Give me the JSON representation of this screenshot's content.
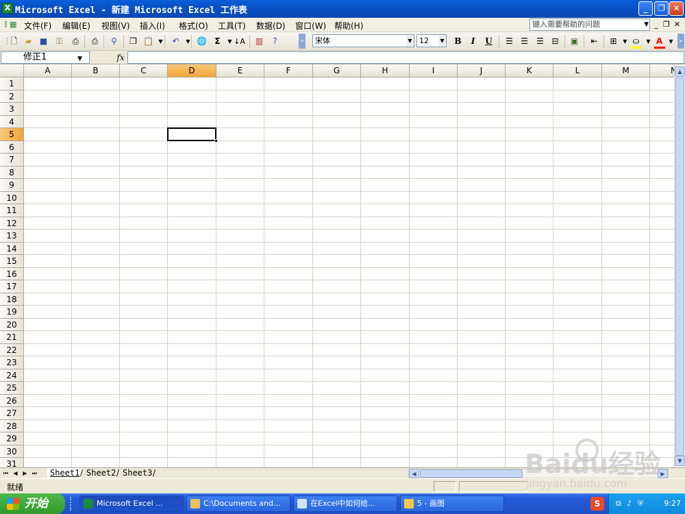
{
  "window": {
    "title": "Microsoft Excel - 新建 Microsoft Excel 工作表",
    "app_icon": "excel-icon",
    "controls": [
      "minimize",
      "restore",
      "close"
    ]
  },
  "menubar": {
    "items": [
      "文件(F)",
      "编辑(E)",
      "视图(V)",
      "插入(I)",
      "格式(O)",
      "工具(T)",
      "数据(D)",
      "窗口(W)",
      "帮助(H)"
    ],
    "help_placeholder": "键入需要帮助的问题"
  },
  "toolbar": {
    "font_name": "宋体",
    "font_size": "12",
    "bold": "B",
    "italic": "I",
    "underline": "U",
    "sum": "Σ",
    "icons": [
      "new-icon",
      "open-icon",
      "save-icon",
      "permission-icon",
      "print-icon",
      "print-preview-icon",
      "research-icon",
      "copy-icon",
      "paste-icon",
      "undo-icon",
      "hyperlink-icon",
      "autosum-icon",
      "sort-ascending-icon",
      "chart-wizard-icon",
      "help-icon",
      "align-left-icon",
      "align-center-icon",
      "align-right-icon",
      "merge-center-icon",
      "currency-icon",
      "decrease-indent-icon",
      "borders-icon",
      "fill-color-icon",
      "font-color-icon"
    ],
    "accent_fill": "#ffff00",
    "accent_font": "#ff0000"
  },
  "formula_bar": {
    "name_box": "修正1",
    "fx": "fx",
    "formula": ""
  },
  "grid": {
    "columns": [
      "A",
      "B",
      "C",
      "D",
      "E",
      "F",
      "G",
      "H",
      "I",
      "J",
      "K",
      "L",
      "M",
      "N"
    ],
    "rows": [
      "1",
      "2",
      "3",
      "4",
      "5",
      "6",
      "7",
      "8",
      "9",
      "10",
      "11",
      "12",
      "13",
      "14",
      "15",
      "16",
      "17",
      "18",
      "19",
      "20",
      "21",
      "22",
      "23",
      "24",
      "25",
      "26",
      "27",
      "28",
      "29",
      "30",
      "31"
    ],
    "active_column": "D",
    "active_row": "5"
  },
  "sheets": {
    "tabs": [
      "Sheet1",
      "Sheet2",
      "Sheet3"
    ],
    "active": "Sheet1"
  },
  "status": {
    "text": "就绪"
  },
  "taskbar": {
    "start_label": "开始",
    "buttons": [
      {
        "label": "Microsoft Excel ...",
        "icon": "excel-icon"
      },
      {
        "label": "C:\\Documents and...",
        "icon": "folder-icon"
      },
      {
        "label": "在Excel中如何给...",
        "icon": "browser-icon"
      },
      {
        "label": "5 - 画图",
        "icon": "paint-icon"
      }
    ],
    "clock": "9:27"
  },
  "watermark": {
    "brand": "Baidu经验",
    "url": "jingyan.baidu.com"
  }
}
